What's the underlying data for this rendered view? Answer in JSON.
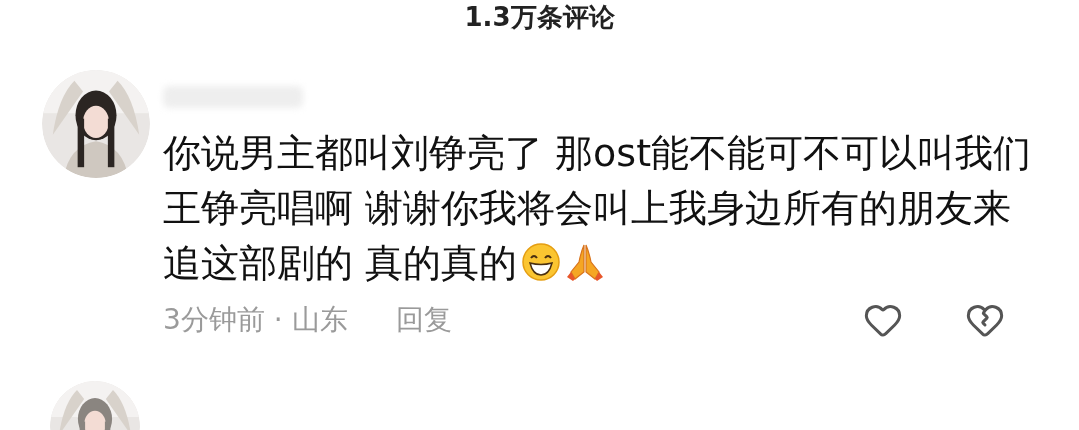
{
  "header": {
    "title": "1.3万条评论"
  },
  "comment": {
    "text": "你说男主都叫刘铮亮了 那ost能不能可不可以叫我们王铮亮唱啊 谢谢你我将会叫上我身边所有的朋友来追这部剧的 真的真的",
    "time_location": "3分钟前 · 山东",
    "reply": "回复"
  }
}
